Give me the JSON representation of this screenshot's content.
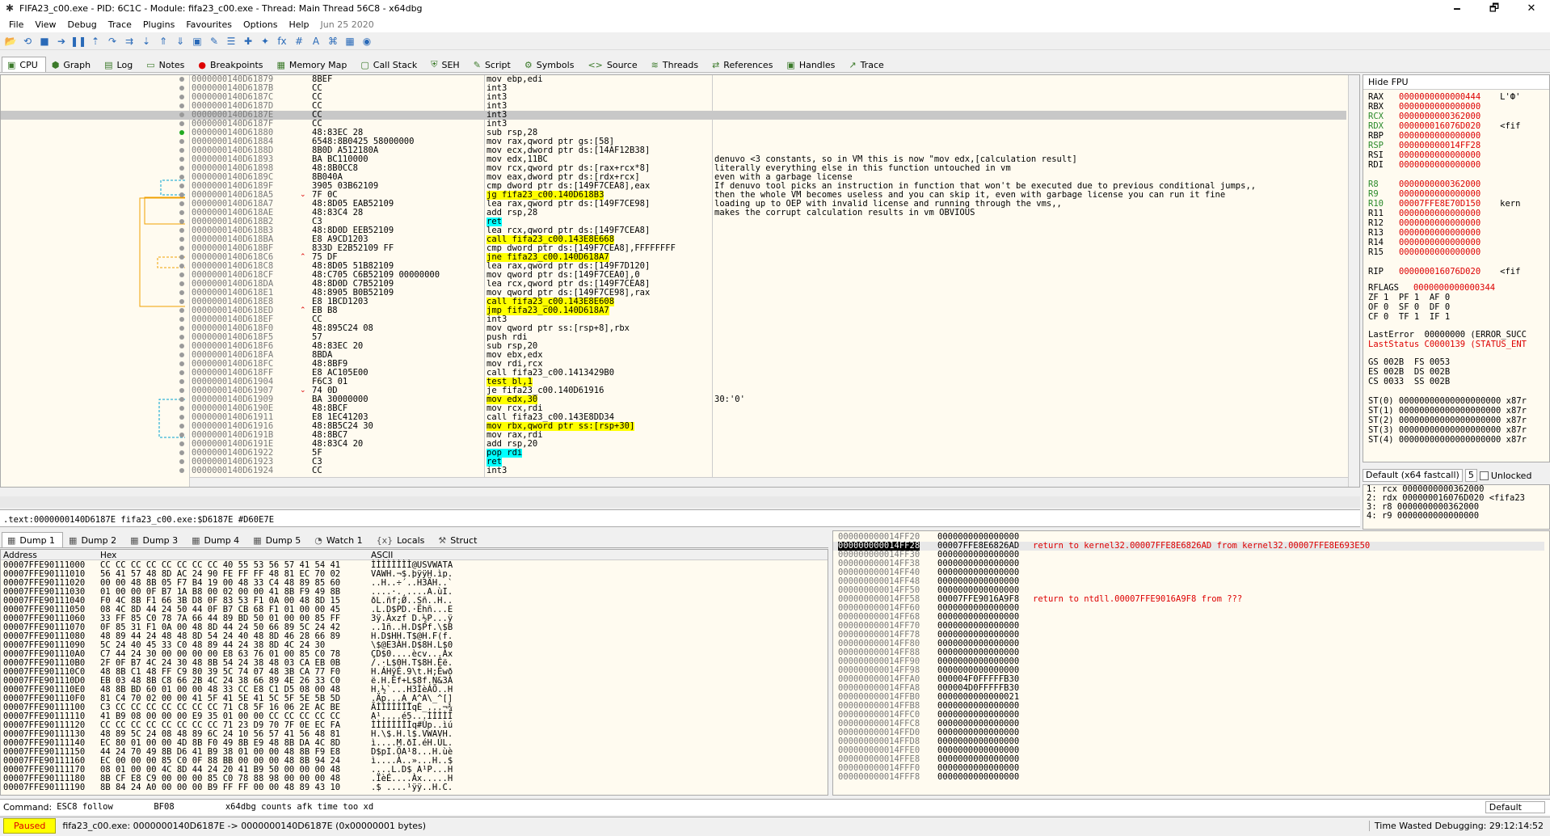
{
  "window": {
    "title": "FIFA23_c00.exe - PID: 6C1C - Module: fifa23_c00.exe - Thread: Main Thread 56C8 - x64dbg",
    "minimize": "🗕",
    "maximize": "🗗",
    "close": "✕"
  },
  "menu": {
    "items": [
      "File",
      "View",
      "Debug",
      "Trace",
      "Plugins",
      "Favourites",
      "Options",
      "Help"
    ],
    "date": "Jun 25 2020"
  },
  "toolbar": {
    "icons": [
      "open-icon",
      "restart-icon",
      "close-file-icon",
      "run-icon",
      "pause-icon",
      "step-into-icon",
      "step-over-icon",
      "trace-into-icon",
      "trace-over-icon",
      "execute-till-return-icon",
      "run-to-user-code-icon",
      "scylla-icon",
      "patch-icon",
      "comment-icon",
      "label-icon",
      "bookmark-icon",
      "function-icon",
      "hash-icon",
      "font-icon",
      "strings-icon",
      "calculator-icon",
      "settings-icon"
    ],
    "glyphs": [
      "📂",
      "⟲",
      "■",
      "➔",
      "❚❚",
      "⇡",
      "↷",
      "⇉",
      "⇣",
      "⇑",
      "⇓",
      "▣",
      "✎",
      "☰",
      "✚",
      "✦",
      "fx",
      "#",
      "A",
      "⌘",
      "▦",
      "◉"
    ]
  },
  "tabs": [
    {
      "label": "CPU",
      "icon": "cpu-icon"
    },
    {
      "label": "Graph",
      "icon": "graph-icon"
    },
    {
      "label": "Log",
      "icon": "log-icon"
    },
    {
      "label": "Notes",
      "icon": "notes-icon"
    },
    {
      "label": "Breakpoints",
      "icon": "breakpoint-icon"
    },
    {
      "label": "Memory Map",
      "icon": "memory-map-icon"
    },
    {
      "label": "Call Stack",
      "icon": "call-stack-icon"
    },
    {
      "label": "SEH",
      "icon": "seh-icon"
    },
    {
      "label": "Script",
      "icon": "script-icon"
    },
    {
      "label": "Symbols",
      "icon": "symbols-icon"
    },
    {
      "label": "Source",
      "icon": "source-icon"
    },
    {
      "label": "Threads",
      "icon": "threads-icon"
    },
    {
      "label": "References",
      "icon": "references-icon"
    },
    {
      "label": "Handles",
      "icon": "handles-icon"
    },
    {
      "label": "Trace",
      "icon": "trace-icon"
    }
  ],
  "disasm": [
    {
      "addr": "0000000140D61879",
      "bytes": "8BEF",
      "dis": "mov ebp,edi",
      "com": ""
    },
    {
      "addr": "0000000140D6187B",
      "bytes": "CC",
      "dis": "int3",
      "com": ""
    },
    {
      "addr": "0000000140D6187C",
      "bytes": "CC",
      "dis": "int3",
      "com": ""
    },
    {
      "addr": "0000000140D6187D",
      "bytes": "CC",
      "dis": "int3",
      "com": ""
    },
    {
      "addr": "0000000140D6187E",
      "bytes": "CC",
      "dis": "int3",
      "com": ""
    },
    {
      "addr": "0000000140D6187F",
      "bytes": "CC",
      "dis": "int3",
      "com": ""
    },
    {
      "addr": "0000000140D61880",
      "bytes": "48:83EC 28",
      "dis": "sub rsp,28",
      "com": ""
    },
    {
      "addr": "0000000140D61884",
      "bytes": "6548:8B0425 58000000",
      "dis": "mov rax,qword ptr gs:[58]",
      "com": ""
    },
    {
      "addr": "0000000140D6188D",
      "bytes": "8B0D A512180A",
      "dis": "mov ecx,dword ptr ds:[14AF12B38]",
      "com": ""
    },
    {
      "addr": "0000000140D61893",
      "bytes": "BA BC110000",
      "dis": "mov edx,11BC",
      "com": "denuvo <3 constants, so in VM this is now \"mov edx,[calculation result]"
    },
    {
      "addr": "0000000140D61898",
      "bytes": "48:8B0CC8",
      "dis": "mov rcx,qword ptr ds:[rax+rcx*8]",
      "com": "literally everything else in this function untouched in vm"
    },
    {
      "addr": "0000000140D6189C",
      "bytes": "8B040A",
      "dis": "mov eax,dword ptr ds:[rdx+rcx]",
      "com": "even with a garbage license"
    },
    {
      "addr": "0000000140D6189F",
      "bytes": "3905 03B62109",
      "dis": "cmp dword ptr ds:[149F7CEA8],eax",
      "com": "If denuvo tool picks an instruction in function that won't be executed due to previous conditional jumps,,"
    },
    {
      "addr": "0000000140D618A5",
      "bytes": "7F 0C",
      "dis": "jg fifa23_c00.140D618B3",
      "com": "then the whole VM becomes useless and you can skip it, even with garbage license you can run it fine"
    },
    {
      "addr": "0000000140D618A7",
      "bytes": "48:8D05 EAB52109",
      "dis": "lea rax,qword ptr ds:[149F7CE98]",
      "com": "loading up to OEP with invalid license and running through the vms,,"
    },
    {
      "addr": "0000000140D618AE",
      "bytes": "48:83C4 28",
      "dis": "add rsp,28",
      "com": "makes the corrupt calculation results in vm OBVIOUS"
    },
    {
      "addr": "0000000140D618B2",
      "bytes": "C3",
      "dis": "ret",
      "com": ""
    },
    {
      "addr": "0000000140D618B3",
      "bytes": "48:8D0D EEB52109",
      "dis": "lea rcx,qword ptr ds:[149F7CEA8]",
      "com": ""
    },
    {
      "addr": "0000000140D618BA",
      "bytes": "E8 A9CD1203",
      "dis": "call fifa23_c00.143E8E668",
      "com": ""
    },
    {
      "addr": "0000000140D618BF",
      "bytes": "833D E2B52109 FF",
      "dis": "cmp dword ptr ds:[149F7CEA8],FFFFFFFF",
      "com": ""
    },
    {
      "addr": "0000000140D618C6",
      "bytes": "75 DF",
      "dis": "jne fifa23_c00.140D618A7",
      "com": ""
    },
    {
      "addr": "0000000140D618C8",
      "bytes": "48:8D05 51B82109",
      "dis": "lea rax,qword ptr ds:[149F7D120]",
      "com": ""
    },
    {
      "addr": "0000000140D618CF",
      "bytes": "48:C705 C6B52109 00000000",
      "dis": "mov qword ptr ds:[149F7CEA0],0",
      "com": ""
    },
    {
      "addr": "0000000140D618DA",
      "bytes": "48:8D0D C7B52109",
      "dis": "lea rcx,qword ptr ds:[149F7CEA8]",
      "com": ""
    },
    {
      "addr": "0000000140D618E1",
      "bytes": "48:8905 B0B52109",
      "dis": "mov qword ptr ds:[149F7CE98],rax",
      "com": ""
    },
    {
      "addr": "0000000140D618E8",
      "bytes": "E8 1BCD1203",
      "dis": "call fifa23_c00.143E8E608",
      "com": ""
    },
    {
      "addr": "0000000140D618ED",
      "bytes": "EB B8",
      "dis": "jmp fifa23_c00.140D618A7",
      "com": ""
    },
    {
      "addr": "0000000140D618EF",
      "bytes": "CC",
      "dis": "int3",
      "com": ""
    },
    {
      "addr": "0000000140D618F0",
      "bytes": "48:895C24 08",
      "dis": "mov qword ptr ss:[rsp+8],rbx",
      "com": ""
    },
    {
      "addr": "0000000140D618F5",
      "bytes": "57",
      "dis": "push rdi",
      "com": ""
    },
    {
      "addr": "0000000140D618F6",
      "bytes": "48:83EC 20",
      "dis": "sub rsp,20",
      "com": ""
    },
    {
      "addr": "0000000140D618FA",
      "bytes": "8BDA",
      "dis": "mov ebx,edx",
      "com": ""
    },
    {
      "addr": "0000000140D618FC",
      "bytes": "48:8BF9",
      "dis": "mov rdi,rcx",
      "com": ""
    },
    {
      "addr": "0000000140D618FF",
      "bytes": "E8 AC105E00",
      "dis": "call fifa23_c00.1413429B0",
      "com": ""
    },
    {
      "addr": "0000000140D61904",
      "bytes": "F6C3 01",
      "dis": "test bl,1",
      "com": ""
    },
    {
      "addr": "0000000140D61907",
      "bytes": "74 0D",
      "dis": "je fifa23_c00.140D61916",
      "com": ""
    },
    {
      "addr": "0000000140D61909",
      "bytes": "BA 30000000",
      "dis": "mov edx,30",
      "com": "30:'0'"
    },
    {
      "addr": "0000000140D6190E",
      "bytes": "48:8BCF",
      "dis": "mov rcx,rdi",
      "com": ""
    },
    {
      "addr": "0000000140D61911",
      "bytes": "E8 1EC41203",
      "dis": "call fifa23_c00.143E8DD34",
      "com": ""
    },
    {
      "addr": "0000000140D61916",
      "bytes": "48:8B5C24 30",
      "dis": "mov rbx,qword ptr ss:[rsp+30]",
      "com": ""
    },
    {
      "addr": "0000000140D6191B",
      "bytes": "48:8BC7",
      "dis": "mov rax,rdi",
      "com": ""
    },
    {
      "addr": "0000000140D6191E",
      "bytes": "48:83C4 20",
      "dis": "add rsp,20",
      "com": ""
    },
    {
      "addr": "0000000140D61922",
      "bytes": "5F",
      "dis": "pop rdi",
      "com": ""
    },
    {
      "addr": "0000000140D61923",
      "bytes": "C3",
      "dis": "ret",
      "com": ""
    },
    {
      "addr": "0000000140D61924",
      "bytes": "CC",
      "dis": "int3",
      "com": ""
    }
  ],
  "registers": {
    "header": "Hide FPU",
    "gp": [
      [
        "RAX",
        "0000000000000444",
        "L'Ф'"
      ],
      [
        "RBX",
        "0000000000000000",
        ""
      ],
      [
        "RCX",
        "0000000000362000",
        ""
      ],
      [
        "RDX",
        "000000016076D020",
        "<fif"
      ],
      [
        "RBP",
        "0000000000000000",
        ""
      ],
      [
        "RSP",
        "000000000014FF28",
        ""
      ],
      [
        "RSI",
        "0000000000000000",
        ""
      ],
      [
        "RDI",
        "0000000000000000",
        ""
      ],
      [
        "",
        ""
      ],
      [
        "R8",
        "0000000000362000",
        ""
      ],
      [
        "R9",
        "0000000000000000",
        ""
      ],
      [
        "R10",
        "00007FFE8E70D150",
        "kern"
      ],
      [
        "R11",
        "0000000000000000",
        ""
      ],
      [
        "R12",
        "0000000000000000",
        ""
      ],
      [
        "R13",
        "0000000000000000",
        ""
      ],
      [
        "R14",
        "0000000000000000",
        ""
      ],
      [
        "R15",
        "0000000000000000",
        ""
      ],
      [
        "",
        ""
      ],
      [
        "RIP",
        "000000016076D020",
        "<fif"
      ]
    ],
    "rflags_label": "RFLAGS",
    "rflags": "0000000000000344",
    "flags": [
      "ZF 1  PF 1  AF 0",
      "OF 0  SF 0  DF 0",
      "CF 0  TF 1  IF 1"
    ],
    "lasterror": "LastError  00000000 (ERROR_SUCC",
    "laststatus": "LastStatus C0000139 (STATUS_ENT",
    "segs": [
      "GS 002B  FS 0053",
      "ES 002B  DS 002B",
      "CS 0033  SS 002B"
    ],
    "st": [
      "ST(0) 00000000000000000000 x87r",
      "ST(1) 00000000000000000000 x87r",
      "ST(2) 00000000000000000000 x87r",
      "ST(3) 00000000000000000000 x87r",
      "ST(4) 00000000000000000000 x87r"
    ]
  },
  "callconv": {
    "label": "Default (x64 fastcall)",
    "count": "5",
    "unlocked": "Unlocked"
  },
  "stackargs": [
    "1: rcx 0000000000362000",
    "2: rdx 000000016076D020 <fifa23",
    "3: r8 0000000000362000",
    "4: r9 0000000000000000"
  ],
  "infoline": ".text:0000000140D6187E fifa23_c00.exe:$D6187E #D60E7E",
  "dumptabs": [
    {
      "label": "Dump 1",
      "icon": "dump-icon"
    },
    {
      "label": "Dump 2",
      "icon": "dump-icon"
    },
    {
      "label": "Dump 3",
      "icon": "dump-icon"
    },
    {
      "label": "Dump 4",
      "icon": "dump-icon"
    },
    {
      "label": "Dump 5",
      "icon": "dump-icon"
    },
    {
      "label": "Watch 1",
      "icon": "watch-icon"
    },
    {
      "label": "Locals",
      "icon": "locals-icon"
    },
    {
      "label": "Struct",
      "icon": "struct-icon"
    }
  ],
  "dumpheader": {
    "address": "Address",
    "hex": "Hex",
    "ascii": "ASCII"
  },
  "dump": [
    [
      "00007FFE90111000",
      "CC CC CC CC CC CC CC CC 40 55 53 56 57 41 54 41",
      "ÌÌÌÌÌÌÌÌ@USVWATA"
    ],
    [
      "00007FFE90111010",
      "56 41 57 48 8D AC 24 90 FE FF FF 48 81 EC 70 02",
      "VAWH.¬$.þÿÿH.ìp."
    ],
    [
      "00007FFE90111020",
      "00 00 48 8B 05 F7 B4 19 00 48 33 C4 48 89 85 60",
      "..H..÷´..H3ÄH..`"
    ],
    [
      "00007FFE90111030",
      "01 00 00 0F B7 1A B8 00 02 00 00 41 8B F9 49 8B",
      "....·.¸....A.ùI."
    ],
    [
      "00007FFE90111040",
      "F0 4C 8B F1 66 3B D8 0F 83 53 F1 0A 00 48 8D 15",
      "ðL.ñf;Ø..Sñ..H.."
    ],
    [
      "00007FFE90111050",
      "08 4C 8D 44 24 50 44 0F B7 CB 68 F1 01 00 00 45",
      ".L.D$PD.·Ëhñ...E"
    ],
    [
      "00007FFE90111060",
      "33 FF 85 C0 78 7A 66 44 89 BD 50 01 00 00 85 FF",
      "3ÿ.Àxzf D.½P...ÿ"
    ],
    [
      "00007FFE90111070",
      "0F 85 31 F1 0A 00 48 8D 44 24 50 66 89 5C 24 42",
      "..1ñ..H.D$Pf.\\$B"
    ],
    [
      "00007FFE90111080",
      "48 89 44 24 48 48 8D 54 24 40 48 8D 46 28 66 89",
      "H.D$HH.T$@H.F(f."
    ],
    [
      "00007FFE90111090",
      "5C 24 40 45 33 C0 48 89 44 24 38 8D 4C 24 30",
      "\\$@E3ÀH.D$8H.L$0"
    ],
    [
      "00007FFE901110A0",
      "C7 44 24 30 00 00 00 00 E8 63 76 01 00 85 C0 78",
      "ÇD$0....ècv...Àx"
    ],
    [
      "00007FFE901110B0",
      "2F 0F B7 4C 24 30 48 8B 54 24 38 48 03 CA EB 0B",
      "/.·L$0H.T$8H.Êë."
    ],
    [
      "00007FFE901110C0",
      "48 8B C1 48 FF C9 80 39 5C 74 07 48 3B CA 77 F0",
      "H.ÁHÿÉ.9\\t.H;Êwð"
    ],
    [
      "00007FFE901110D0",
      "EB 03 48 8B C8 66 2B 4C 24 38 66 89 4E 26 33 C0",
      "ë.H.Èf+L$8f.N&3À"
    ],
    [
      "00007FFE901110E0",
      "48 8B BD 60 01 00 00 48 33 CC E8 C1 D5 08 00 48",
      "H.½`...H3ÌèÁÕ..H"
    ],
    [
      "00007FFE901110F0",
      "81 C4 70 02 00 00 41 5F 41 5E 41 5C 5F 5E 5B 5D",
      ".Äp...A_A^A\\_^[]"
    ],
    [
      "00007FFE90111100",
      "C3 CC CC CC CC CC CC CC 71 C8 5F 16 06 2E AC BE",
      "ÃÌÌÌÌÌÌÌqÈ_...¬¾"
    ],
    [
      "00007FFE90111110",
      "41 B9 08 00 00 00 E9 35 01 00 00 CC CC CC CC CC",
      "A¹....é5...ÌÌÌÌÌ"
    ],
    [
      "00007FFE90111120",
      "CC CC CC CC CC CC CC CC 71 23 D9 70 7F 0E EC FA",
      "ÌÌÌÌÌÌÌÌq#Ùp..ìú"
    ],
    [
      "00007FFE90111130",
      "48 89 5C 24 08 48 89 6C 24 10 56 57 41 56 48 81",
      "H.\\$.H.l$.VWAVH."
    ],
    [
      "00007FFE90111140",
      "EC 80 01 00 00 4D 8B F0 49 8B E9 48 8B DA 4C 8D",
      "ì....M.ðI.éH.ÚL."
    ],
    [
      "00007FFE90111150",
      "44 24 70 49 8B D6 41 B9 38 01 00 00 48 8B F9 E8",
      "D$pI.ÖA¹8...H.ùè"
    ],
    [
      "00007FFE90111160",
      "EC 00 00 00 85 C0 0F 88 BB 00 00 00 48 8B 94 24",
      "ì....À..»...H..$"
    ],
    [
      "00007FFE90111170",
      "08 01 00 00 4C 8D 44 24 20 41 B9 50 00 00 00 48",
      "....L.D$ A¹P...H"
    ],
    [
      "00007FFE90111180",
      "8B CF E8 C9 00 00 00 85 C0 78 88 98 00 00 00 48",
      ".ÏèÉ....Àx.....H"
    ],
    [
      "00007FFE90111190",
      "8B 84 24 A0 00 00 00 B9 FF FF 00 00 48 89 43 10",
      ".$ ....¹ÿÿ..H.C."
    ]
  ],
  "stack": [
    [
      "000000000014FF20",
      "0000000000000000",
      ""
    ],
    [
      "000000000014FF28",
      "00007FFE8E6826AD",
      "return to kernel32.00007FFE8E6826AD from kernel32.00007FFE8E693E50"
    ],
    [
      "000000000014FF30",
      "0000000000000000",
      ""
    ],
    [
      "000000000014FF38",
      "0000000000000000",
      ""
    ],
    [
      "000000000014FF40",
      "0000000000000000",
      ""
    ],
    [
      "000000000014FF48",
      "0000000000000000",
      ""
    ],
    [
      "000000000014FF50",
      "0000000000000000",
      ""
    ],
    [
      "000000000014FF58",
      "00007FFE9016A9F8",
      "return to ntdll.00007FFE9016A9F8 from ???"
    ],
    [
      "000000000014FF60",
      "0000000000000000",
      ""
    ],
    [
      "000000000014FF68",
      "0000000000000000",
      ""
    ],
    [
      "000000000014FF70",
      "0000000000000000",
      ""
    ],
    [
      "000000000014FF78",
      "0000000000000000",
      ""
    ],
    [
      "000000000014FF80",
      "0000000000000000",
      ""
    ],
    [
      "000000000014FF88",
      "0000000000000000",
      ""
    ],
    [
      "000000000014FF90",
      "0000000000000000",
      ""
    ],
    [
      "000000000014FF98",
      "0000000000000000",
      ""
    ],
    [
      "000000000014FFA0",
      "000004F0FFFFFB30",
      ""
    ],
    [
      "000000000014FFA8",
      "000004D0FFFFFB30",
      ""
    ],
    [
      "000000000014FFB0",
      "0000000000000021",
      ""
    ],
    [
      "000000000014FFB8",
      "0000000000000000",
      ""
    ],
    [
      "000000000014FFC0",
      "0000000000000000",
      ""
    ],
    [
      "000000000014FFC8",
      "0000000000000000",
      ""
    ],
    [
      "000000000014FFD0",
      "0000000000000000",
      ""
    ],
    [
      "000000000014FFD8",
      "0000000000000000",
      ""
    ],
    [
      "000000000014FFE0",
      "0000000000000000",
      ""
    ],
    [
      "000000000014FFE8",
      "0000000000000000",
      ""
    ],
    [
      "000000000014FFF0",
      "0000000000000000",
      ""
    ],
    [
      "000000000014FFF8",
      "0000000000000000",
      ""
    ]
  ],
  "command": {
    "label": "Command:",
    "text": "ESC8 follow        BF08          x64dbg counts afk time too xd",
    "mode": "Default"
  },
  "status": {
    "state": "Paused",
    "message": "fifa23_c00.exe: 0000000140D6187E -> 0000000140D6187E (0x00000001 bytes)",
    "timer": "Time Wasted Debugging: 29:12:14:52"
  }
}
